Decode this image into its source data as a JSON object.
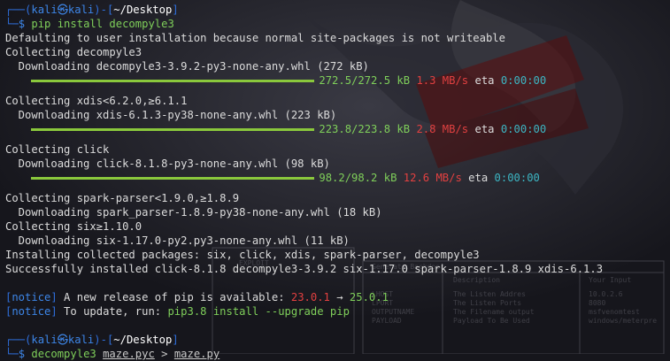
{
  "prompt": {
    "user": "kali",
    "host": "kali",
    "path": "~/Desktop",
    "at": "㉿"
  },
  "commands": {
    "first": "pip install decompyle3",
    "second_cmd": "decompyle3",
    "second_arg1": "maze.pyc",
    "second_redirect": ">",
    "second_arg2": "maze.py"
  },
  "output": {
    "l1": "Defaulting to user installation because normal site-packages is not writeable",
    "l2": "Collecting decompyle3",
    "l3": "  Downloading decompyle3-3.9.2-py3-none-any.whl (272 kB)",
    "p1": {
      "done": "272.5/272.5 kB",
      "speed": "1.3 MB/s",
      "eta_label": "eta",
      "eta": "0:00:00",
      "fraction": 1.0
    },
    "l4": "Collecting xdis<6.2.0,≥6.1.1",
    "l5": "  Downloading xdis-6.1.3-py38-none-any.whl (223 kB)",
    "p2": {
      "done": "223.8/223.8 kB",
      "speed": "2.8 MB/s",
      "eta_label": "eta",
      "eta": "0:00:00",
      "fraction": 1.0
    },
    "l6": "Collecting click",
    "l7": "  Downloading click-8.1.8-py3-none-any.whl (98 kB)",
    "p3": {
      "done": "98.2/98.2 kB",
      "speed": "12.6 MB/s",
      "eta_label": "eta",
      "eta": "0:00:00",
      "fraction": 1.0
    },
    "l8": "Collecting spark-parser<1.9.0,≥1.8.9",
    "l9": "  Downloading spark_parser-1.8.9-py38-none-any.whl (18 kB)",
    "l10": "Collecting six≥1.10.0",
    "l11": "  Downloading six-1.17.0-py2.py3-none-any.whl (11 kB)",
    "l12": "Installing collected packages: six, click, xdis, spark-parser, decompyle3",
    "l13": "Successfully installed click-8.1.8 decompyle3-3.9.2 six-1.17.0 spark-parser-1.8.9 xdis-6.1.3"
  },
  "notice": {
    "tag": "notice",
    "msg1_pre": " A new release of pip is available: ",
    "old_version": "23.0.1",
    "arrow": " → ",
    "new_version": "25.0.1",
    "msg2_pre": " To update, run: ",
    "update_cmd": "pip3.8 install --upgrade pip"
  },
  "colors": {
    "background": "#16161c",
    "prompt_blue": "#3d86e8",
    "progress_green": "#8ac83c",
    "speed_red": "#e24040",
    "eta_cyan": "#3cb6c3"
  }
}
